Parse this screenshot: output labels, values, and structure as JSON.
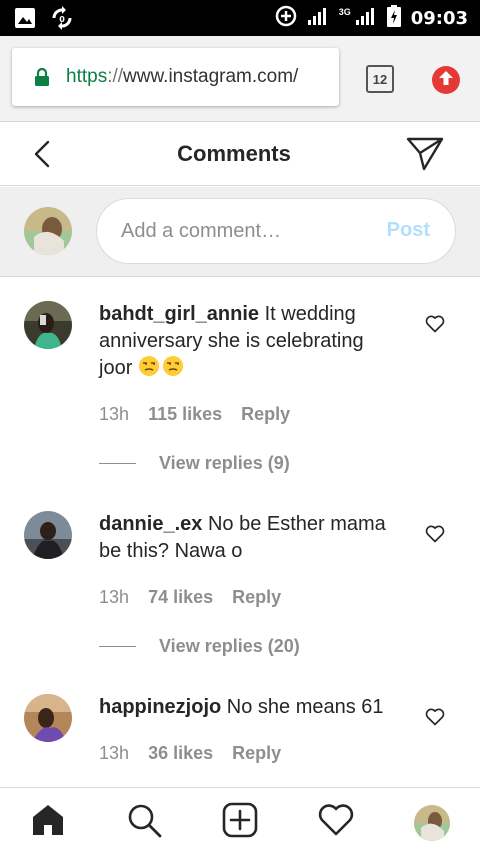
{
  "status_bar": {
    "network": "3G",
    "time": "09:03"
  },
  "browser": {
    "url_scheme": "https",
    "url_sep": "://",
    "url_host": "www.instagram.com/",
    "tab_count": "12"
  },
  "header": {
    "title": "Comments"
  },
  "composer": {
    "placeholder": "Add a comment…",
    "post_label": "Post"
  },
  "comments": [
    {
      "username": "bahdt_girl_annie",
      "text": "It wedding anniversary she is celebrating joor",
      "emoji": "unamused-face-emoji",
      "time": "13h",
      "likes": "115 likes",
      "reply": "Reply",
      "view_replies": "View replies (9)"
    },
    {
      "username": "dannie_.ex",
      "text": "No be Esther mama be this? Nawa o",
      "time": "13h",
      "likes": "74 likes",
      "reply": "Reply",
      "view_replies": "View replies (20)"
    },
    {
      "username": "happinezjojo",
      "text": "No she means 61",
      "time": "13h",
      "likes": "36 likes",
      "reply": "Reply"
    }
  ],
  "colors": {
    "status_bar_bg": "#000000",
    "url_secure_green": "#0b8043",
    "upload_red": "#e53935",
    "post_disabled_blue": "#b2dffc",
    "muted_text": "#8e8e8e"
  },
  "icons": {
    "status_left": [
      "image-icon",
      "sync-icon"
    ],
    "status_right": [
      "data-saver-icon",
      "signal-icon",
      "signal-icon",
      "battery-icon"
    ],
    "nav": [
      "home-icon",
      "search-icon",
      "add-post-icon",
      "heart-icon",
      "profile-avatar"
    ]
  }
}
